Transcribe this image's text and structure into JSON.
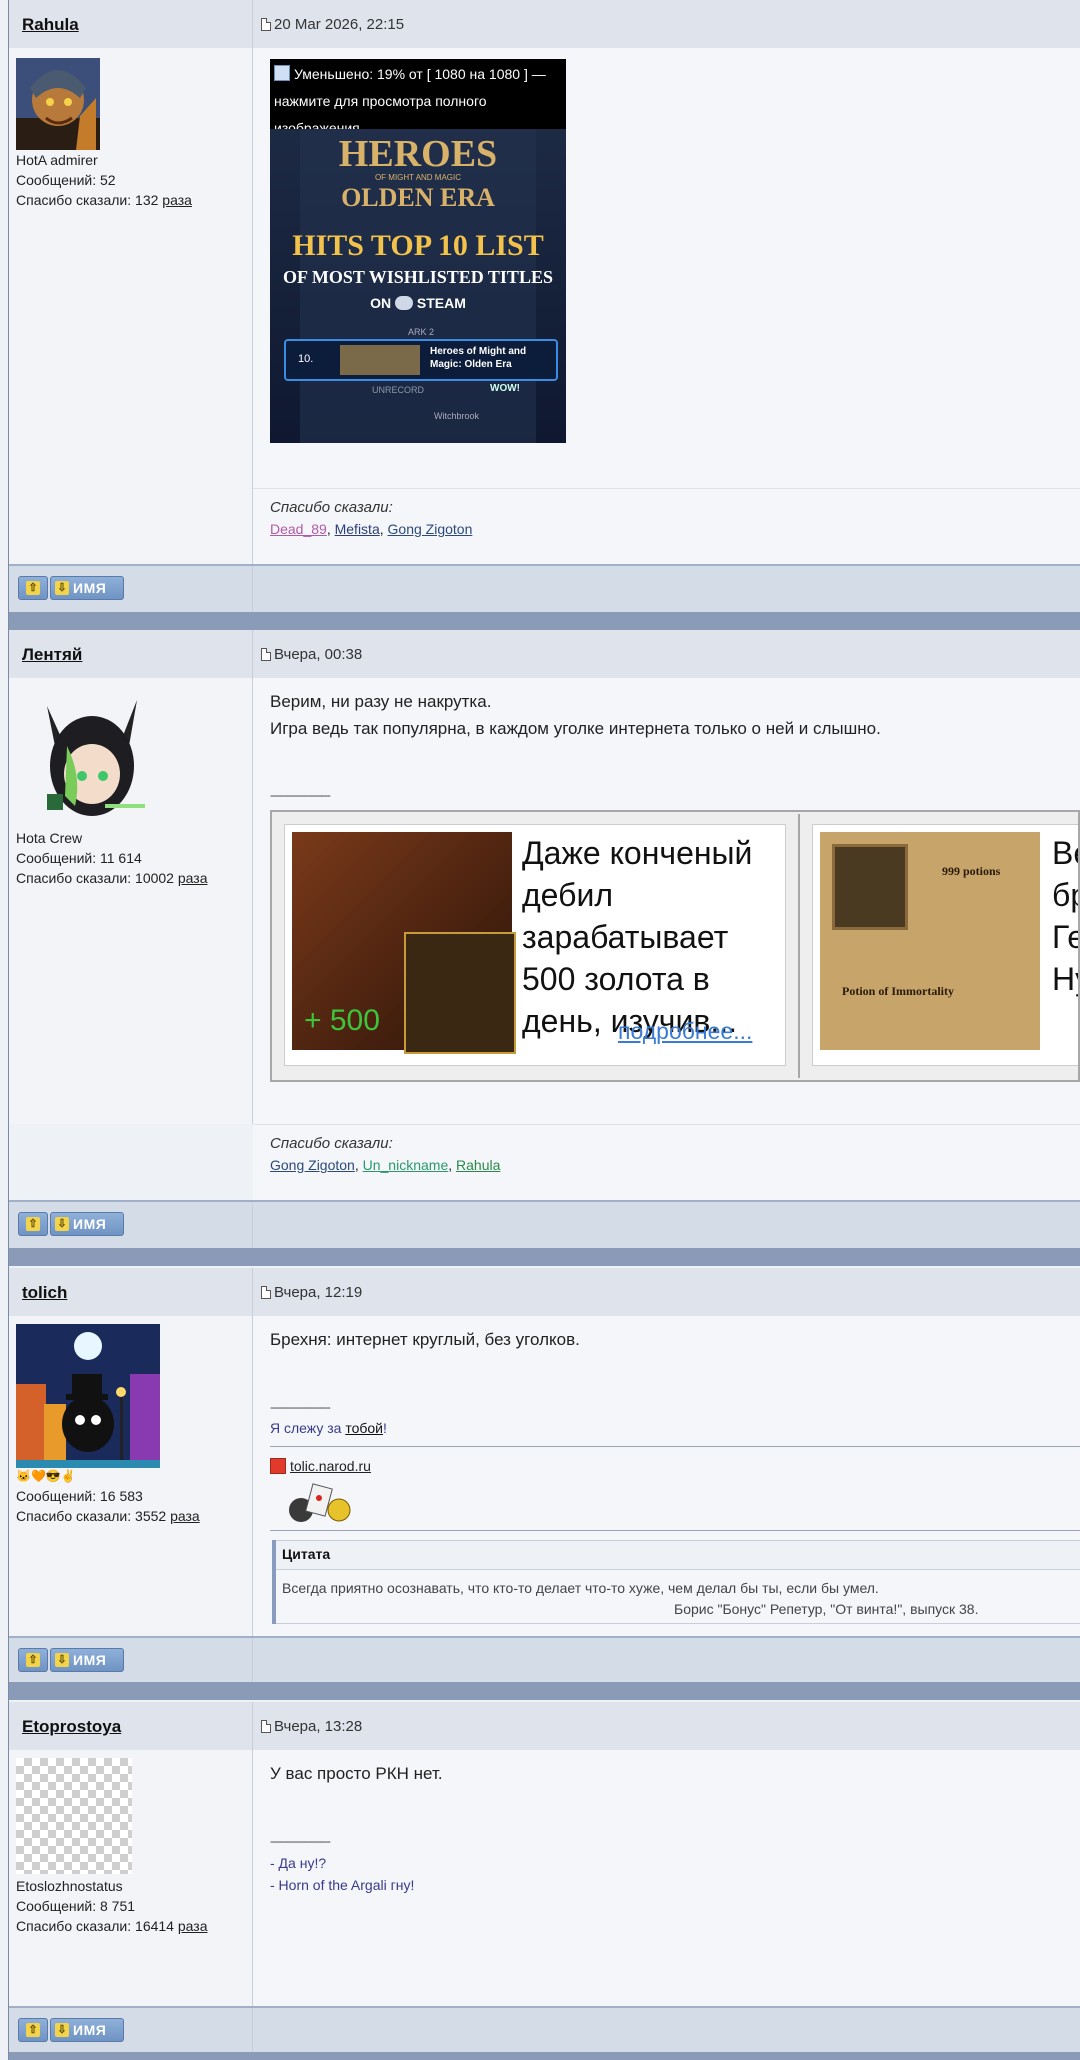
{
  "posts": [
    {
      "author": "Rahula",
      "date": "20 Mar 2026, 22:15",
      "user_title": "HotA admirer",
      "messages_count": "Сообщений: 52",
      "thanks_prefix": "Спасибо сказали: 132",
      "thanks_suffix": "раза",
      "image_notice": "Уменьшено: 19% от [ 1080 на 1080 ] — нажмите для просмотра полного изображения",
      "image_text": {
        "game_title": "HEROES",
        "game_subtitle": "OF MIGHT AND MAGIC",
        "game_edition": "OLDEN ERA",
        "line1": "HITS TOP 10 LIST",
        "line2": "OF MOST WISHLISTED TITLES",
        "line3": "ON",
        "steam": "STEAM",
        "rank": "10.",
        "rank_title": "Heroes of Might and Magic: Olden Era",
        "other1": "ARK 2",
        "other2": "Witchbrook",
        "other3": "WOW!",
        "other4": "UNRECORD"
      },
      "thanks_title": "Спасибо сказали:",
      "thanks": [
        {
          "name": "Dead_89",
          "color": "#b05aa8"
        },
        {
          "name": "Mefista",
          "color": "#2b3d7a"
        },
        {
          "name": "Gong Zigoton",
          "color": "#2b4a7a"
        }
      ]
    },
    {
      "author": "Лентяй",
      "date": "Вчера, 00:38",
      "user_title": "Hota Crew",
      "messages_count": "Сообщений: 11 614",
      "thanks_prefix": "Спасибо сказали: 10002",
      "thanks_suffix": "раза",
      "message_lines": [
        "Верим, ни разу не накрутка.",
        "Игра ведь так популярна, в каждом уголке интернета только о ней и слышно."
      ],
      "signature_sep": "--------------------",
      "ad1": {
        "text": "Даже конченый дебил зарабатывает 500 золота в день, изучив...",
        "more": "подробнее...",
        "bonus": "+ 500"
      },
      "ad2": {
        "text": "Ве бр Ге Ну",
        "label1": "999 potions",
        "label2": "Potion of Immortality"
      },
      "thanks_title": "Спасибо сказали:",
      "thanks": [
        {
          "name": "Gong Zigoton",
          "color": "#2b4a7a"
        },
        {
          "name": "Un_nickname",
          "color": "#2a9a6a"
        },
        {
          "name": "Rahula",
          "color": "#2a8a4a"
        }
      ]
    },
    {
      "author": "tolich",
      "date": "Вчера, 12:19",
      "user_emojis": "🐱🧡😎✌",
      "messages_count": "Сообщений: 16 583",
      "thanks_prefix": "Спасибо сказали: 3552",
      "thanks_suffix": "раза",
      "message_lines": [
        "Брехня: интернет круглый, без уголков."
      ],
      "signature_sep": "--------------------",
      "sig_line_prefix": "Я слежу за",
      "sig_line_link": "тобой",
      "sig_line_suffix": "!",
      "site_link": "tolic.narod.ru",
      "quote_title": "Цитата",
      "quote_text": "Всегда приятно осознавать, что кто-то делает что-то хуже, чем делал бы ты, если бы умел.",
      "quote_author": "Борис \"Бонус\" Репетур, \"От винта!\", выпуск 38."
    },
    {
      "author": "Etoprostoya",
      "date": "Вчера, 13:28",
      "user_title": "Etoslozhnostatus",
      "messages_count": "Сообщений: 8 751",
      "thanks_prefix": "Спасибо сказали: 16414",
      "thanks_suffix": "раза",
      "message_lines": [
        "У вас просто РКН нет."
      ],
      "signature_sep": "--------------------",
      "sig_lines": [
        "- Да ну!?",
        "- Horn of the Argali гну!"
      ]
    }
  ],
  "footer_buttons": {
    "up": "⇧",
    "down": "⇩",
    "name": "ИМЯ"
  }
}
